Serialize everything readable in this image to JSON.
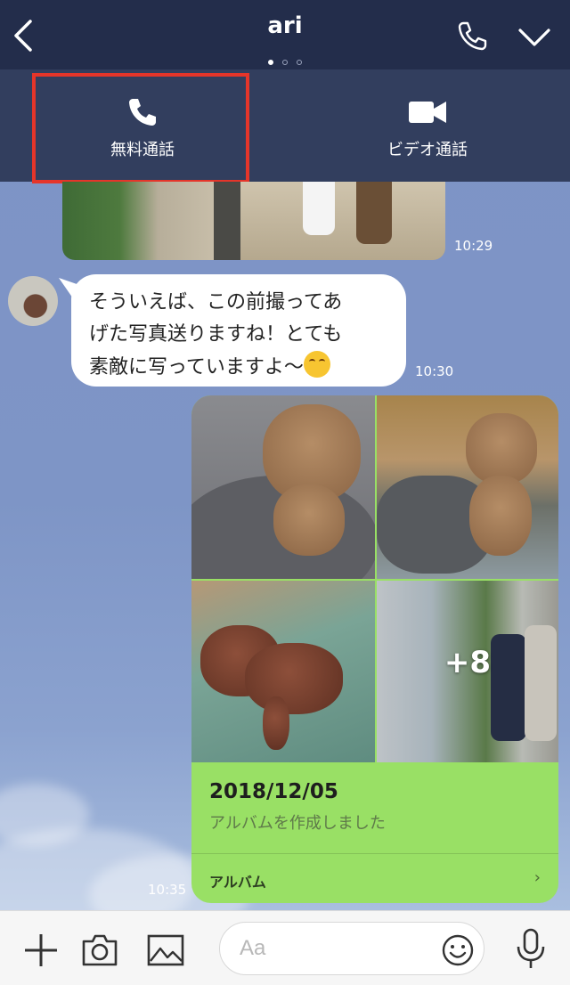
{
  "header": {
    "title": "ari",
    "page_dots": 3,
    "active_dot": 0,
    "back_icon": "chevron-left-icon",
    "call_icon": "phone-icon",
    "expand_icon": "chevron-down-icon"
  },
  "call_menu": {
    "free_call_label": "無料通話",
    "video_call_label": "ビデオ通話",
    "highlight_color": "#e5352a"
  },
  "messages": [
    {
      "type": "photo",
      "time": "10:29"
    },
    {
      "type": "text",
      "lines": [
        "そういえば、この前撮ってあ",
        "げた写真送りますね！とても",
        "素敵に写っていますよ〜"
      ],
      "time": "10:30"
    },
    {
      "type": "album",
      "more_count": "+8",
      "date": "2018/12/05",
      "description": "アルバムを作成しました",
      "link_label": "アルバム",
      "link_arrow": "›",
      "time": "10:35"
    }
  ],
  "bottom_bar": {
    "input_placeholder": "Aa",
    "icons": [
      "plus-icon",
      "camera-icon",
      "image-icon",
      "emoji-icon",
      "microphone-icon"
    ]
  },
  "colors": {
    "header_bg": "#232d4b",
    "chat_bg": "#7d93c6",
    "my_bubble": "#99e065",
    "their_bubble": "#ffffff"
  }
}
